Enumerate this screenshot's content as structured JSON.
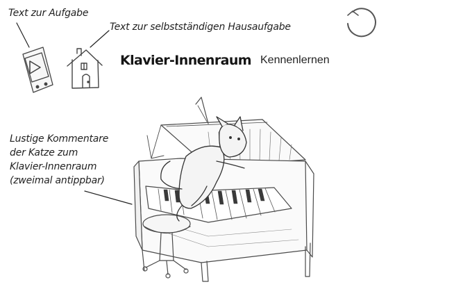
{
  "annotations": {
    "task_text": "Text zur Aufgabe",
    "homework_text": "Text zur selbstständigen Hausaufgabe",
    "cat_comments": [
      "Lustige Kommentare",
      "der Katze zum",
      "Klavier-Innenraum",
      "(zweimal antippbar)"
    ]
  },
  "header": {
    "title": "Klavier-Innenraum",
    "subtitle": "Kennenlernen"
  },
  "icons": {
    "task": "audio-player-icon",
    "homework": "house-icon",
    "reset": "reload-icon",
    "illustration": "cat-playing-piano-sketch"
  }
}
